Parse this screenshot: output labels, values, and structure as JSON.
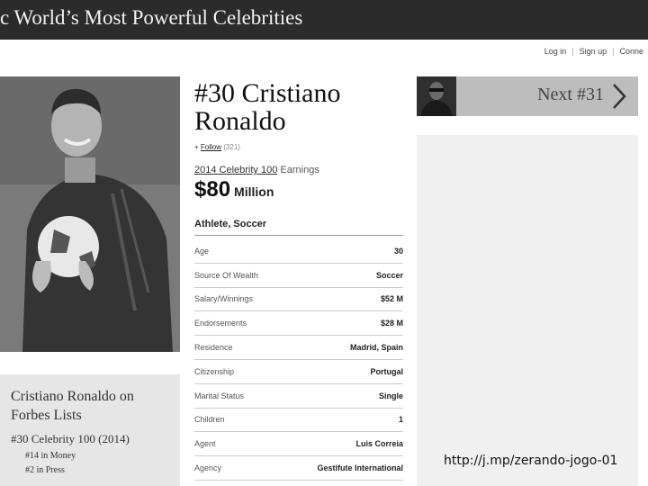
{
  "banner": {
    "title": "c World’s Most Powerful Celebrities"
  },
  "account_links": {
    "login": "Log in",
    "signup": "Sign up",
    "connect": "Conne",
    "separator": "|"
  },
  "profile": {
    "name_line1": "#30 Cristiano",
    "name_line2": "Ronaldo",
    "follow_prefix": "+",
    "follow_label": "Follow",
    "follow_count": "(321)",
    "earnings_label_link": "2014 Celebrity 100",
    "earnings_label_rest": "Earnings",
    "earnings_amount": "$80",
    "earnings_unit": "Million",
    "category": "Athlete, Soccer",
    "stats": [
      {
        "label": "Age",
        "value": "30"
      },
      {
        "label": "Source Of Wealth",
        "value": "Soccer"
      },
      {
        "label": "Salary/Winnings",
        "value": "$52 M"
      },
      {
        "label": "Endorsements",
        "value": "$28 M"
      },
      {
        "label": "Residence",
        "value": "Madrid, Spain"
      },
      {
        "label": "Citizenship",
        "value": "Portugal"
      },
      {
        "label": "Marital Status",
        "value": "Single"
      },
      {
        "label": "Children",
        "value": "1"
      },
      {
        "label": "Agent",
        "value": "Luis Correia"
      },
      {
        "label": "Agency",
        "value": "Gestifute International"
      }
    ]
  },
  "lists": {
    "title_line1": "Cristiano Ronaldo on",
    "title_line2": "Forbes Lists",
    "rank": "#30 Celebrity 100 (2014)",
    "sub1": "#14 in Money",
    "sub2": "#2 in Press"
  },
  "next_nav": {
    "label": "Next #31"
  },
  "overlay": {
    "url": "http://j.mp/zerando-jogo-01"
  },
  "colors": {
    "banner": "#2b2b2b",
    "nav_bg": "#bdbdbd",
    "lists_bg": "#e6e6e6",
    "ad_bg": "#f0f0f0"
  }
}
